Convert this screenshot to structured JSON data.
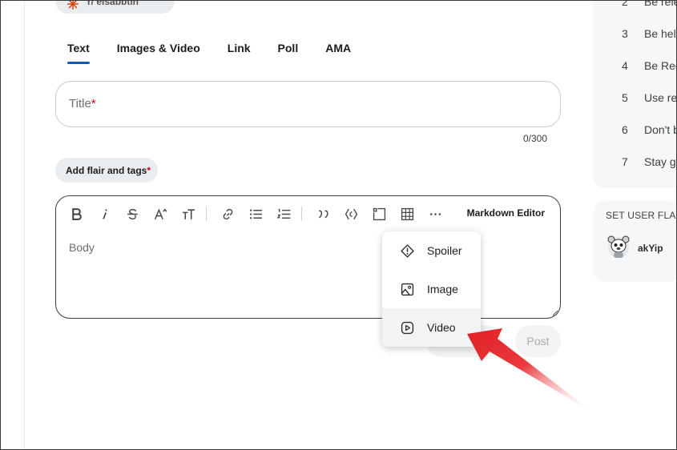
{
  "community": {
    "label": "r/ elsabbtin"
  },
  "tabs": [
    {
      "label": "Text",
      "active": true
    },
    {
      "label": "Images & Video",
      "active": false
    },
    {
      "label": "Link",
      "active": false
    },
    {
      "label": "Poll",
      "active": false
    },
    {
      "label": "AMA",
      "active": false
    }
  ],
  "title_field": {
    "placeholder": "Title",
    "required_mark": "*",
    "counter": "0/300"
  },
  "flair_button": {
    "label": "Add flair and tags",
    "required_mark": "*"
  },
  "editor": {
    "toolbar_icons": [
      "bold-icon",
      "italic-icon",
      "strikethrough-icon",
      "superscript-icon",
      "heading-icon",
      "link-icon",
      "bullet-list-icon",
      "numbered-list-icon",
      "quote-icon",
      "code-icon",
      "code-block-icon",
      "table-icon",
      "more-icon"
    ],
    "markdown_label": "Markdown Editor",
    "body_placeholder": "Body"
  },
  "actions": {
    "post_label": "Post"
  },
  "dropdown": {
    "items": [
      {
        "label": "Spoiler",
        "icon": "spoiler-icon"
      },
      {
        "label": "Image",
        "icon": "image-icon"
      },
      {
        "label": "Video",
        "icon": "video-icon",
        "highlighted": true
      }
    ]
  },
  "sidebar": {
    "rules": [
      {
        "num": "2",
        "text": "Be rele"
      },
      {
        "num": "3",
        "text": "Be help"
      },
      {
        "num": "4",
        "text": "Be Rec"
      },
      {
        "num": "5",
        "text": "Use rel"
      },
      {
        "num": "6",
        "text": "Don't b"
      },
      {
        "num": "7",
        "text": "Stay gu"
      }
    ],
    "flair": {
      "title": "SET USER FLAIR",
      "username": "akYip"
    }
  },
  "colors": {
    "accent": "#0a5bc4",
    "required": "#d0021b",
    "arrow": "#e8262a"
  }
}
